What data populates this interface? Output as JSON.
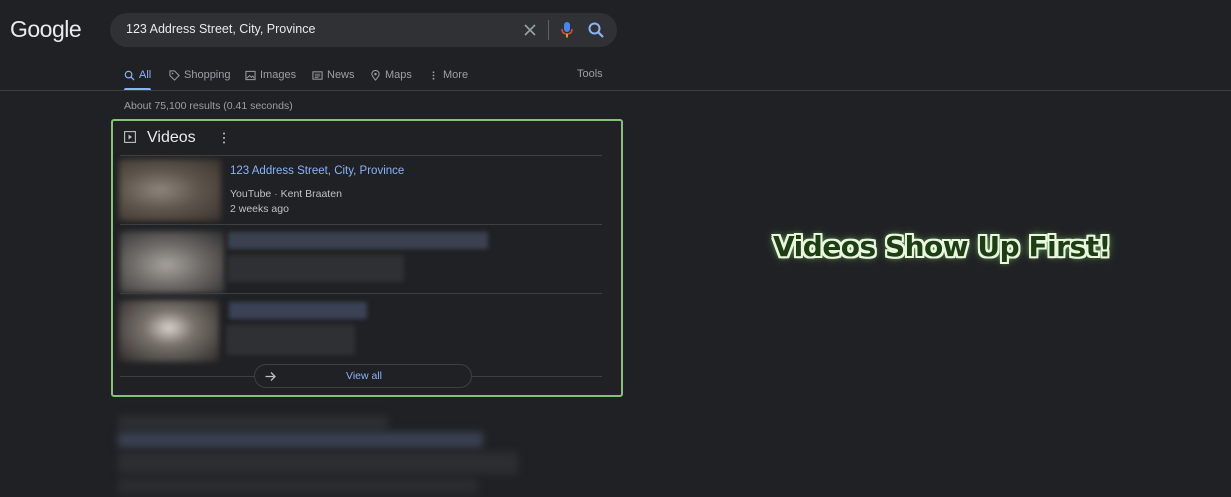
{
  "logo": "Google",
  "search": {
    "query": "123 Address Street, City, Province",
    "icons": [
      "close-icon",
      "mic-icon",
      "search-icon"
    ]
  },
  "tabs": [
    {
      "label": "All",
      "icon": "search-icon",
      "active": true
    },
    {
      "label": "Shopping",
      "icon": "tag-icon"
    },
    {
      "label": "Images",
      "icon": "image-icon"
    },
    {
      "label": "News",
      "icon": "news-icon"
    },
    {
      "label": "Maps",
      "icon": "map-pin-icon"
    },
    {
      "label": "More",
      "icon": "vertical-dots-icon"
    }
  ],
  "tools_label": "Tools",
  "result_stats": "About 75,100 results (0.41 seconds)",
  "videos": {
    "heading": "Videos",
    "items": [
      {
        "title": "123 Address Street, City, Province",
        "source": "YouTube",
        "author": "Kent Braaten",
        "age": "2 weeks ago"
      }
    ],
    "view_all_label": "View all"
  },
  "callout": "Videos Show Up First!",
  "colors": {
    "background": "#202124",
    "link": "#8ab4f8",
    "highlight_border": "#86c17a",
    "callout_fill": "#1e3d14",
    "callout_outline": "#e9f7df"
  }
}
